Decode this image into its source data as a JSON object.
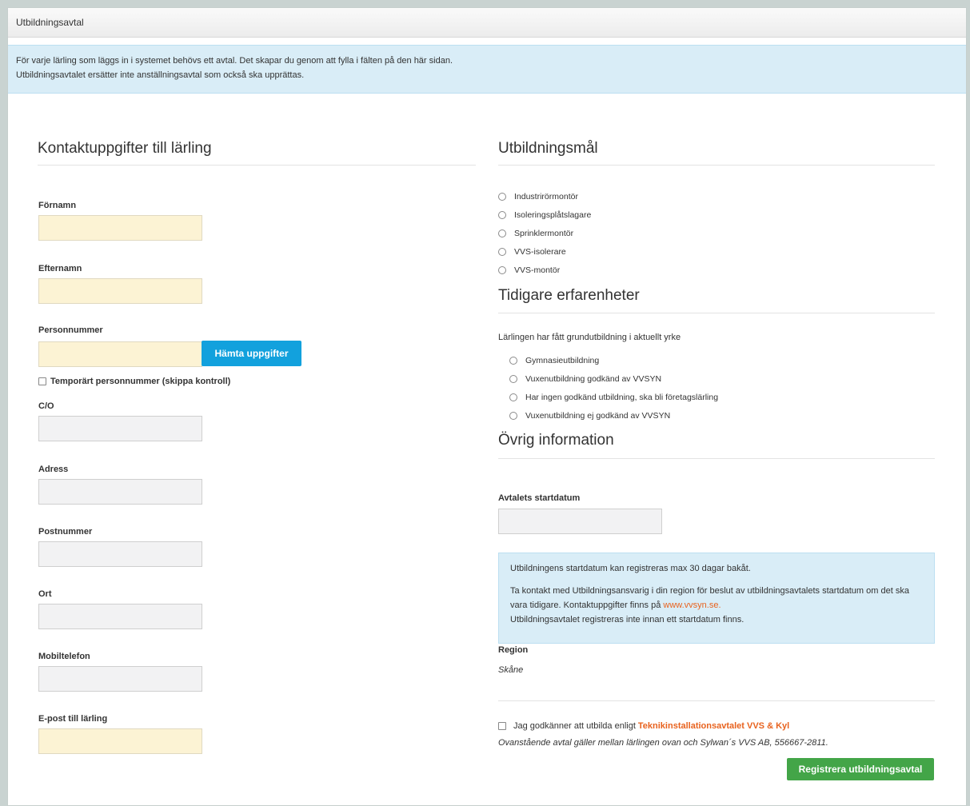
{
  "header": {
    "title": "Utbildningsavtal"
  },
  "banner": {
    "line1": "För varje lärling som läggs in i systemet behövs ett avtal. Det skapar du genom att fylla i fälten på den här sidan.",
    "line2": "Utbildningsavtalet ersätter inte anställningsavtal som också ska upprättas."
  },
  "contact": {
    "title": "Kontaktuppgifter till lärling",
    "fornamn_label": "Förnamn",
    "efternamn_label": "Efternamn",
    "personnummer_label": "Personnummer",
    "fetch_button": "Hämta uppgifter",
    "temp_checkbox_label": "Temporärt personnummer (skippa kontroll)",
    "co_label": "C/O",
    "adress_label": "Adress",
    "postnummer_label": "Postnummer",
    "ort_label": "Ort",
    "mobil_label": "Mobiltelefon",
    "email_label": "E-post till lärling",
    "values": {
      "fornamn": "",
      "efternamn": "",
      "personnummer": "",
      "co": "",
      "adress": "",
      "postnummer": "",
      "ort": "",
      "mobil": "",
      "email": ""
    }
  },
  "goals": {
    "title": "Utbildningsmål",
    "options": [
      "Industrirörmontör",
      "Isoleringsplåtslagare",
      "Sprinklermontör",
      "VVS-isolerare",
      "VVS-montör"
    ]
  },
  "experience": {
    "title": "Tidigare erfarenheter",
    "question": "Lärlingen har fått grundutbildning i aktuellt yrke",
    "options": [
      "Gymnasieutbildning",
      "Vuxenutbildning godkänd av VVSYN",
      "Har ingen godkänd utbildning, ska bli företagslärling",
      "Vuxenutbildning ej godkänd av VVSYN"
    ]
  },
  "other": {
    "title": "Övrig information",
    "start_label": "Avtalets startdatum",
    "start_value": "",
    "note_p1": "Utbildningens startdatum kan registreras max 30 dagar bakåt.",
    "note_p2_a": "Ta kontakt med Utbildningsansvarig i din region för beslut av utbildningsavtalets startdatum om det ska vara tidigare. Kontaktuppgifter finns på ",
    "note_link": "www.vvsyn.se.",
    "note_p2_b": "Utbildningsavtalet registreras inte innan ett startdatum finns.",
    "region_label": "Region",
    "region_value": "Skåne"
  },
  "agreement": {
    "checkbox_text": "Jag godkänner att utbilda enligt ",
    "link_text": "Teknikinstallationsavtalet VVS & Kyl",
    "footnote": "Ovanstående avtal gäller mellan lärlingen ovan och Sylwan´s VVS AB, 556667-2811.",
    "register_button": "Registrera utbildningsavtal"
  },
  "colors": {
    "required_field": "#fcf3d4",
    "field": "#f2f2f3",
    "primary_button": "#12a1dd",
    "success_button": "#43a548",
    "link": "#e8621e",
    "info_bg": "#d9edf7"
  }
}
